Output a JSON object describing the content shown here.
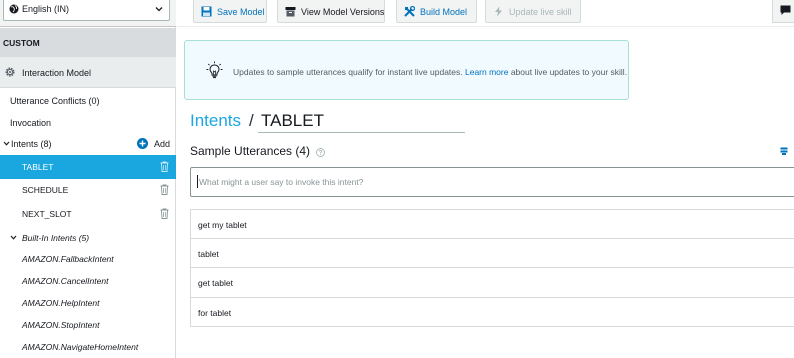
{
  "locale": {
    "label": "English (IN)"
  },
  "sidebar": {
    "section_header": "CUSTOM",
    "interaction_model": "Interaction Model",
    "utterance_conflicts": "Utterance Conflicts (0)",
    "invocation": "Invocation",
    "intents_header": "Intents (8)",
    "add_label": "Add",
    "custom_intents": [
      {
        "label": "TABLET",
        "selected": true
      },
      {
        "label": "SCHEDULE",
        "selected": false
      },
      {
        "label": "NEXT_SLOT",
        "selected": false
      }
    ],
    "builtin_header": "Built-In Intents (5)",
    "builtin_intents": [
      "AMAZON.FallbackIntent",
      "AMAZON.CancelIntent",
      "AMAZON.HelpIntent",
      "AMAZON.StopIntent",
      "AMAZON.NavigateHomeIntent"
    ]
  },
  "toolbar": {
    "save_model": "Save Model",
    "view_versions": "View Model Versions",
    "build_model": "Build Model",
    "update_live": "Update live skill"
  },
  "info_banner": {
    "text_before": "Updates to sample utterances qualify for instant live updates. ",
    "link": "Learn more",
    "text_after": " about live updates to your skill."
  },
  "breadcrumb": {
    "parent": "Intents",
    "separator": "/",
    "current": "TABLET"
  },
  "sample_utterances": {
    "title": "Sample Utterances (4)",
    "placeholder": "What might a user say to invoke this intent?",
    "items": [
      "get my tablet",
      "tablet",
      "get tablet",
      "for tablet"
    ]
  },
  "colors": {
    "accent": "#1aa7e0",
    "link": "#0073bb",
    "banner_bg": "#f1faff",
    "banner_border": "#a6dfd4"
  }
}
